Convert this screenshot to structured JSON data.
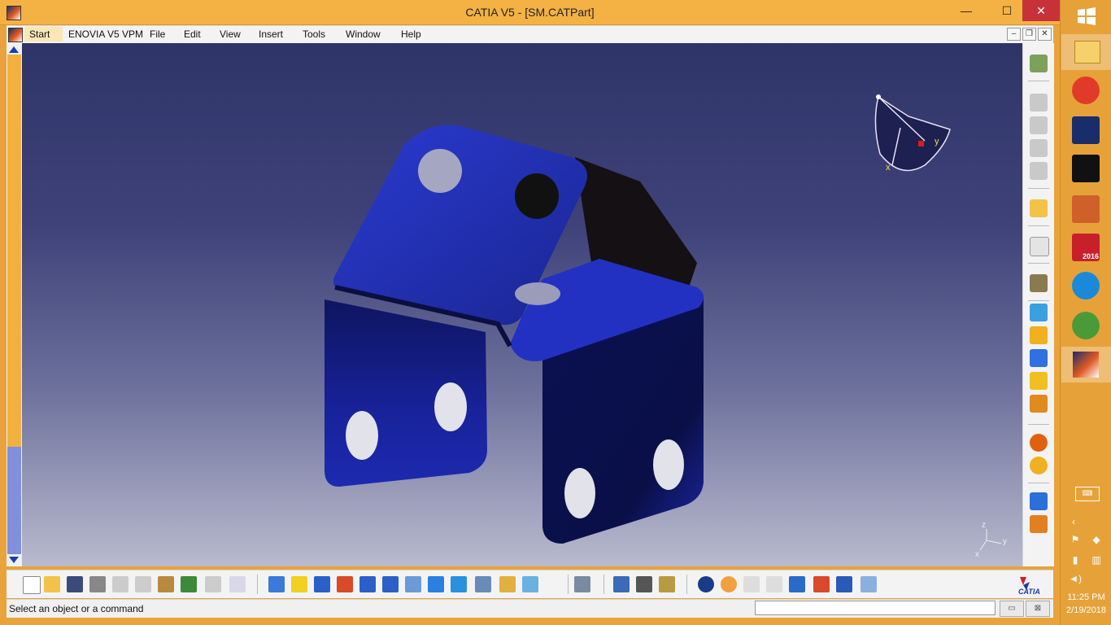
{
  "window": {
    "title": "CATIA V5 - [SM.CATPart]",
    "minimize": "—",
    "maximize": "☐",
    "close": "✕"
  },
  "menu": {
    "items": [
      "Start",
      "ENOVIA V5 VPM",
      "File",
      "Edit",
      "View",
      "Insert",
      "Tools",
      "Window",
      "Help"
    ],
    "mdi_minimize": "–",
    "mdi_restore": "❐",
    "mdi_close": "✕"
  },
  "compass": {
    "x_label": "x",
    "y_label": "y"
  },
  "axis": {
    "x": "x",
    "y": "y",
    "z": "z"
  },
  "brand": {
    "logo_text": "CATIA"
  },
  "status": {
    "message": "Select an object or a command",
    "command_value": ""
  },
  "taskbar": {
    "time": "11:25 PM",
    "date": "2/19/2018",
    "solidworks_badge": "2016"
  },
  "colors": {
    "titlebar": "#f4b245",
    "part_blue": "#1f2fb3",
    "viewport_top": "#2f3468",
    "viewport_bottom": "#b9bace"
  }
}
